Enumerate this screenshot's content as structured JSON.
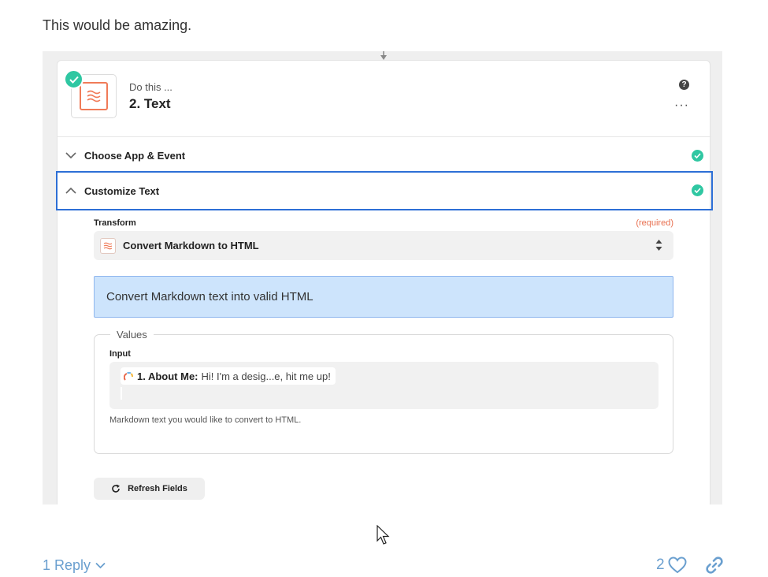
{
  "post": {
    "text": "This would be amazing."
  },
  "zap": {
    "step": {
      "prefix": "Do this ...",
      "title": "2. Text"
    },
    "sections": [
      {
        "label": "Choose App & Event"
      },
      {
        "label": "Customize Text"
      }
    ],
    "transform": {
      "label": "Transform",
      "required": "(required)",
      "value": "Convert Markdown to HTML"
    },
    "info": "Convert Markdown text into valid HTML",
    "values": {
      "legend": "Values",
      "input_label": "Input",
      "pill_name": "1. About Me:",
      "pill_value": "Hi! I'm a desig...e, hit me up!",
      "help": "Markdown text you would like to convert to HTML."
    },
    "refresh_label": "Refresh Fields"
  },
  "footer": {
    "reply_label": "1 Reply",
    "like_count": "2"
  },
  "colors": {
    "accent": "#2fc7a2",
    "focus": "#2d6fd6",
    "link": "#6a9fcf",
    "brand": "#f07b58"
  }
}
